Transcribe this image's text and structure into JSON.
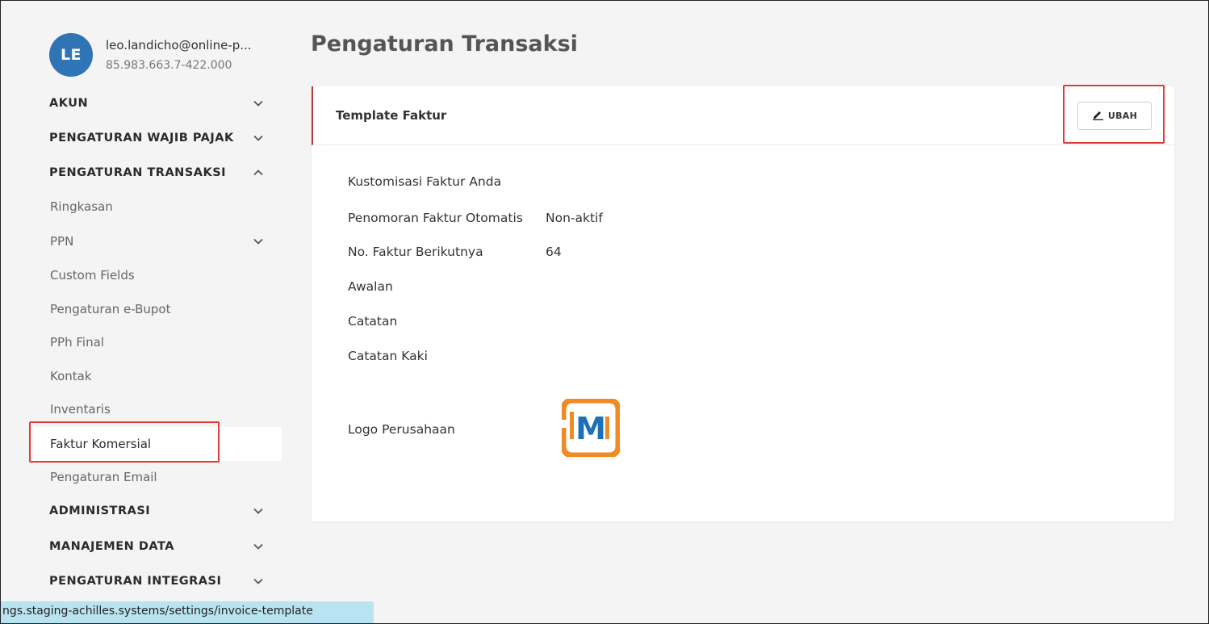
{
  "profile": {
    "initials": "LE",
    "email": "leo.landicho@online-p...",
    "npwp": "85.983.663.7-422.000"
  },
  "sidebar": {
    "items": [
      {
        "label": "AKUN",
        "type": "section",
        "chevron": "down"
      },
      {
        "label": "PENGATURAN WAJIB PAJAK",
        "type": "section",
        "chevron": "down"
      },
      {
        "label": "PENGATURAN TRANSAKSI",
        "type": "section",
        "chevron": "up"
      },
      {
        "label": "Ringkasan",
        "type": "sub"
      },
      {
        "label": "PPN",
        "type": "sub",
        "chevron": "down"
      },
      {
        "label": "Custom Fields",
        "type": "sub"
      },
      {
        "label": "Pengaturan e-Bupot",
        "type": "sub"
      },
      {
        "label": "PPh Final",
        "type": "sub"
      },
      {
        "label": "Kontak",
        "type": "sub"
      },
      {
        "label": "Inventaris",
        "type": "sub"
      },
      {
        "label": "Faktur Komersial",
        "type": "sub",
        "active": true
      },
      {
        "label": "Pengaturan Email",
        "type": "sub"
      },
      {
        "label": "ADMINISTRASI",
        "type": "section",
        "chevron": "down"
      },
      {
        "label": "MANAJEMEN DATA",
        "type": "section",
        "chevron": "down"
      },
      {
        "label": "PENGATURAN INTEGRASI",
        "type": "section",
        "chevron": "down"
      }
    ]
  },
  "main": {
    "title": "Pengaturan Transaksi",
    "card": {
      "title": "Template Faktur",
      "edit_label": "UBAH",
      "fields": [
        {
          "label": "Kustomisasi Faktur Anda",
          "value": ""
        },
        {
          "label": "Penomoran Faktur Otomatis",
          "value": "Non-aktif"
        },
        {
          "label": "No. Faktur Berikutnya",
          "value": "64"
        },
        {
          "label": "Awalan",
          "value": ""
        },
        {
          "label": "Catatan",
          "value": ""
        },
        {
          "label": "Catatan Kaki",
          "value": ""
        },
        {
          "label": "Logo Perusahaan",
          "value": ""
        }
      ],
      "logo_letter": "M"
    }
  },
  "status_bar": {
    "url": "ngs.staging-achilles.systems/settings/invoice-template"
  },
  "colors": {
    "avatar": "#2f74b5",
    "highlight": "#e03a3a",
    "logo_orange": "#f08a24",
    "logo_blue": "#1c6fb8",
    "status_bar": "#b9e3f0"
  }
}
